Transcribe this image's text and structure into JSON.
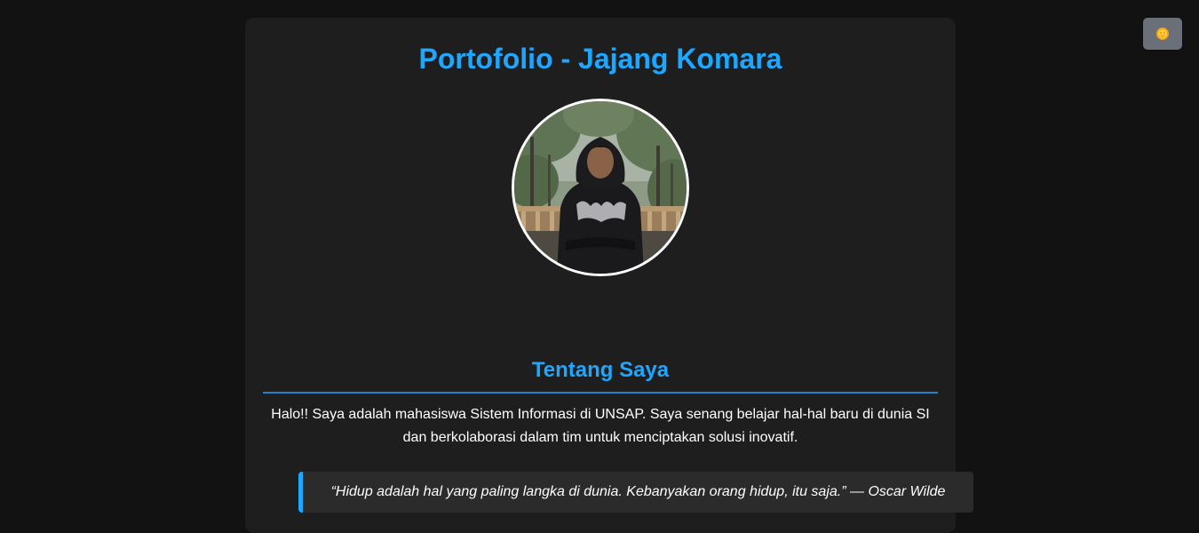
{
  "header": {
    "title": "Portofolio - Jajang Komara"
  },
  "theme_toggle": {
    "icon": "sun-icon",
    "glyph": "🌞"
  },
  "profile": {
    "avatar_icon": "profile-photo"
  },
  "about": {
    "heading": "Tentang Saya",
    "text": "Halo!! Saya adalah mahasiswa Sistem Informasi di UNSAP. Saya senang belajar hal-hal baru di dunia SI dan berkolaborasi dalam tim untuk menciptakan solusi inovatif.",
    "quote": "“Hidup adalah hal yang paling langka di dunia. Kebanyakan orang hidup, itu saja.” — Oscar Wilde"
  },
  "colors": {
    "background": "#121212",
    "card": "#1e1e1e",
    "accent": "#1ea7ff",
    "quote_bg": "#2b2b2b",
    "toggle_bg": "#6b7078"
  }
}
